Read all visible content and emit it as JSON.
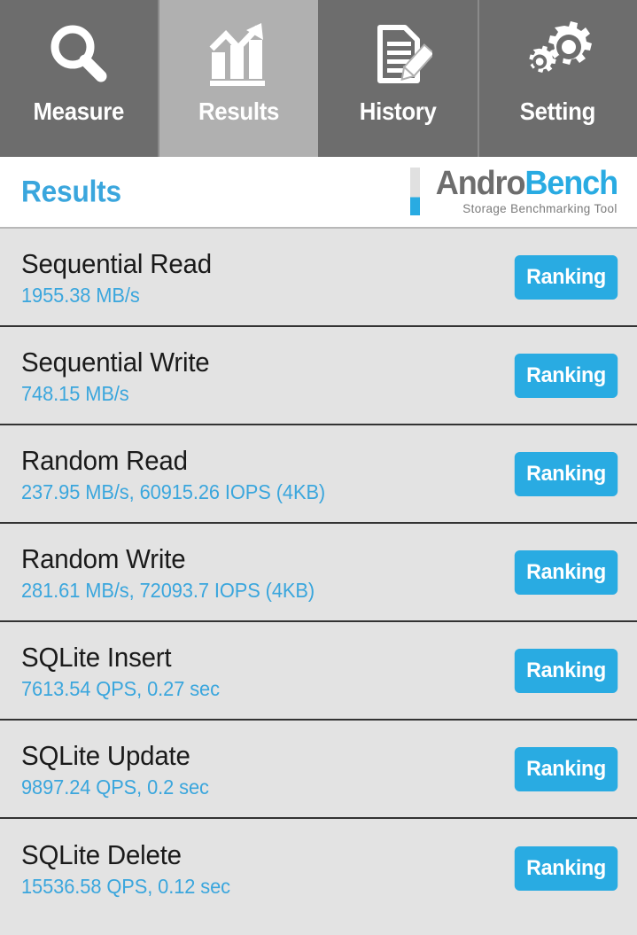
{
  "tabs": [
    {
      "label": "Measure",
      "icon": "magnifier-icon",
      "active": false
    },
    {
      "label": "Results",
      "icon": "bar-chart-arrow-icon",
      "active": true
    },
    {
      "label": "History",
      "icon": "document-pencil-icon",
      "active": false
    },
    {
      "label": "Setting",
      "icon": "gears-icon",
      "active": false
    }
  ],
  "header": {
    "title": "Results",
    "logo": {
      "name_first": "Andro",
      "name_second": "Bench",
      "tagline": "Storage Benchmarking Tool"
    }
  },
  "colors": {
    "accent_blue": "#29abe2",
    "title_blue": "#3aa6dd",
    "tab_inactive": "#6d6d6d",
    "tab_active": "#b0b0b0",
    "list_bg": "#e3e3e3",
    "separator": "#333333",
    "logo_gray": "#6d6d6d"
  },
  "results": {
    "button_label": "Ranking",
    "rows": [
      {
        "title": "Sequential Read",
        "value": "1955.38 MB/s"
      },
      {
        "title": "Sequential Write",
        "value": "748.15 MB/s"
      },
      {
        "title": "Random Read",
        "value": "237.95 MB/s, 60915.26 IOPS (4KB)"
      },
      {
        "title": "Random Write",
        "value": "281.61 MB/s, 72093.7 IOPS (4KB)"
      },
      {
        "title": "SQLite Insert",
        "value": "7613.54 QPS, 0.27 sec"
      },
      {
        "title": "SQLite Update",
        "value": "9897.24 QPS, 0.2 sec"
      },
      {
        "title": "SQLite Delete",
        "value": "15536.58 QPS, 0.12 sec"
      }
    ]
  }
}
